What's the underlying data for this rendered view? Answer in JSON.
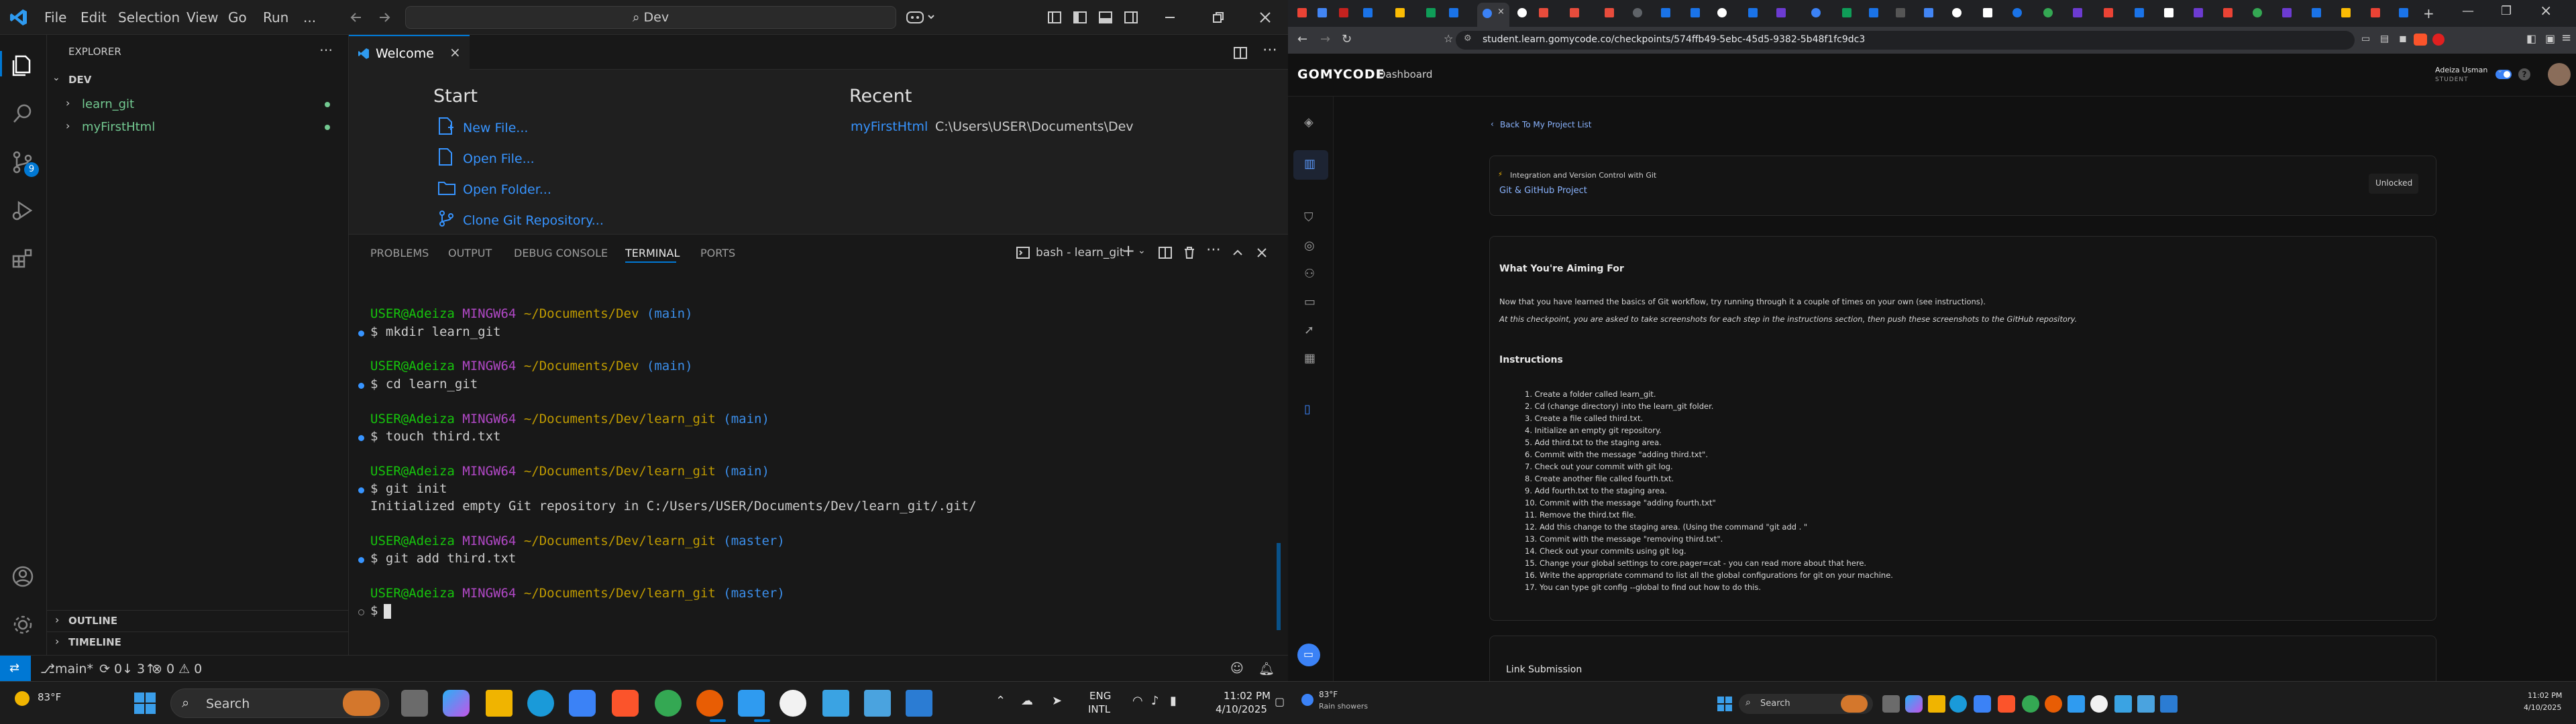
{
  "vscode": {
    "menu": [
      "File",
      "Edit",
      "Selection",
      "View",
      "Go",
      "Run",
      "..."
    ],
    "search": "Dev",
    "explorer_title": "EXPLORER",
    "folder": "DEV",
    "tree": [
      "learn_git",
      "myFirstHtml"
    ],
    "outline": "OUTLINE",
    "timeline": "TIMELINE",
    "scm_badge": "9",
    "tab": "Welcome",
    "start_title": "Start",
    "start_items": [
      "New File...",
      "Open File...",
      "Open Folder...",
      "Clone Git Repository..."
    ],
    "recent_title": "Recent",
    "recent_name": "myFirstHtml",
    "recent_path": "C:\\Users\\USER\\Documents\\Dev",
    "panel_tabs": [
      "PROBLEMS",
      "OUTPUT",
      "DEBUG CONSOLE",
      "TERMINAL",
      "PORTS"
    ],
    "terminal_name": "bash - learn_git",
    "terminal": [
      {
        "user": "USER@Adeiza",
        "host": "MINGW64",
        "path": "~/Documents/Dev",
        "branch": "(main)",
        "cmd": "$ mkdir learn_git",
        "out": ""
      },
      {
        "user": "USER@Adeiza",
        "host": "MINGW64",
        "path": "~/Documents/Dev",
        "branch": "(main)",
        "cmd": "$ cd learn_git",
        "out": ""
      },
      {
        "user": "USER@Adeiza",
        "host": "MINGW64",
        "path": "~/Documents/Dev/learn_git",
        "branch": "(main)",
        "cmd": "$ touch third.txt",
        "out": ""
      },
      {
        "user": "USER@Adeiza",
        "host": "MINGW64",
        "path": "~/Documents/Dev/learn_git",
        "branch": "(main)",
        "cmd": "$ git init",
        "out": "Initialized empty Git repository in C:/Users/USER/Documents/Dev/learn_git/.git/"
      },
      {
        "user": "USER@Adeiza",
        "host": "MINGW64",
        "path": "~/Documents/Dev/learn_git",
        "branch": "(master)",
        "cmd": "$ git add third.txt",
        "out": ""
      },
      {
        "user": "USER@Adeiza",
        "host": "MINGW64",
        "path": "~/Documents/Dev/learn_git",
        "branch": "(master)",
        "cmd": "$ ",
        "out": ""
      }
    ],
    "status_branch": "main*",
    "status_sync": "0↓ 3↑",
    "status_problems": "⊗ 0  ⚠ 0"
  },
  "browser": {
    "url": "student.learn.gomycode.co/checkpoints/574ffb49-5ebc-45d5-9382-5b48f1fc9dc3",
    "logo": "GOMYCODE",
    "nav": "Dashboard",
    "user_name": "Adeiza Usman",
    "user_role": "STUDENT",
    "back": "Back To My Project List",
    "module": "Integration and Version Control with Git",
    "project": "Git & GitHub Project",
    "status": "Unlocked",
    "aim_title": "What You're Aiming For",
    "aim_p1": "Now that you have learned the basics of Git workflow, try running through it a couple of times on your own (see instructions).",
    "aim_p2": "At this checkpoint, you are asked to take screenshots for each step in the instructions section, then push these screenshots to the GitHub repository.",
    "instr_title": "Instructions",
    "steps": [
      "1. Create a folder called learn_git.",
      "2. Cd (change directory) into the learn_git folder.",
      "3. Create a file called third.txt.",
      "4. Initialize an empty git repository.",
      "5. Add third.txt to the staging area.",
      "6. Commit with the message \"adding third.txt\".",
      "7. Check out your commit with git log.",
      "8. Create another file called fourth.txt.",
      "9. Add fourth.txt to the staging area.",
      "10. Commit with the message \"adding fourth.txt\"",
      "11. Remove the third.txt file.",
      "12. Add this change to the staging area. (Using the command \"git add . \"",
      "13. Commit with the message \"removing third.txt\".",
      "14. Check out your commits using git log.",
      "15. Change your global settings to core.pager=cat - you can read more about that here.",
      "16. Write the appropriate command to list all the global configurations for git on your machine.",
      "17. You can type git config --global to find out how to do this."
    ],
    "link_title": "Link Submission"
  },
  "taskbar": {
    "weather_temp": "83°F",
    "search": "Search",
    "lang1": "ENG",
    "lang2": "INTL",
    "time": "11:02 PM",
    "date": "4/10/2025",
    "weather2_temp": "83°F",
    "weather2_desc": "Rain showers",
    "search2": "Search",
    "time2": "11:02 PM",
    "date2": "4/10/2025"
  },
  "colors": {
    "accent": "#0078d4",
    "gomycode_blue": "#3b82f6",
    "terminal_green": "#16c60c",
    "terminal_magenta": "#b148c6",
    "terminal_yellow": "#c19c00",
    "terminal_blue": "#3b8eea"
  }
}
